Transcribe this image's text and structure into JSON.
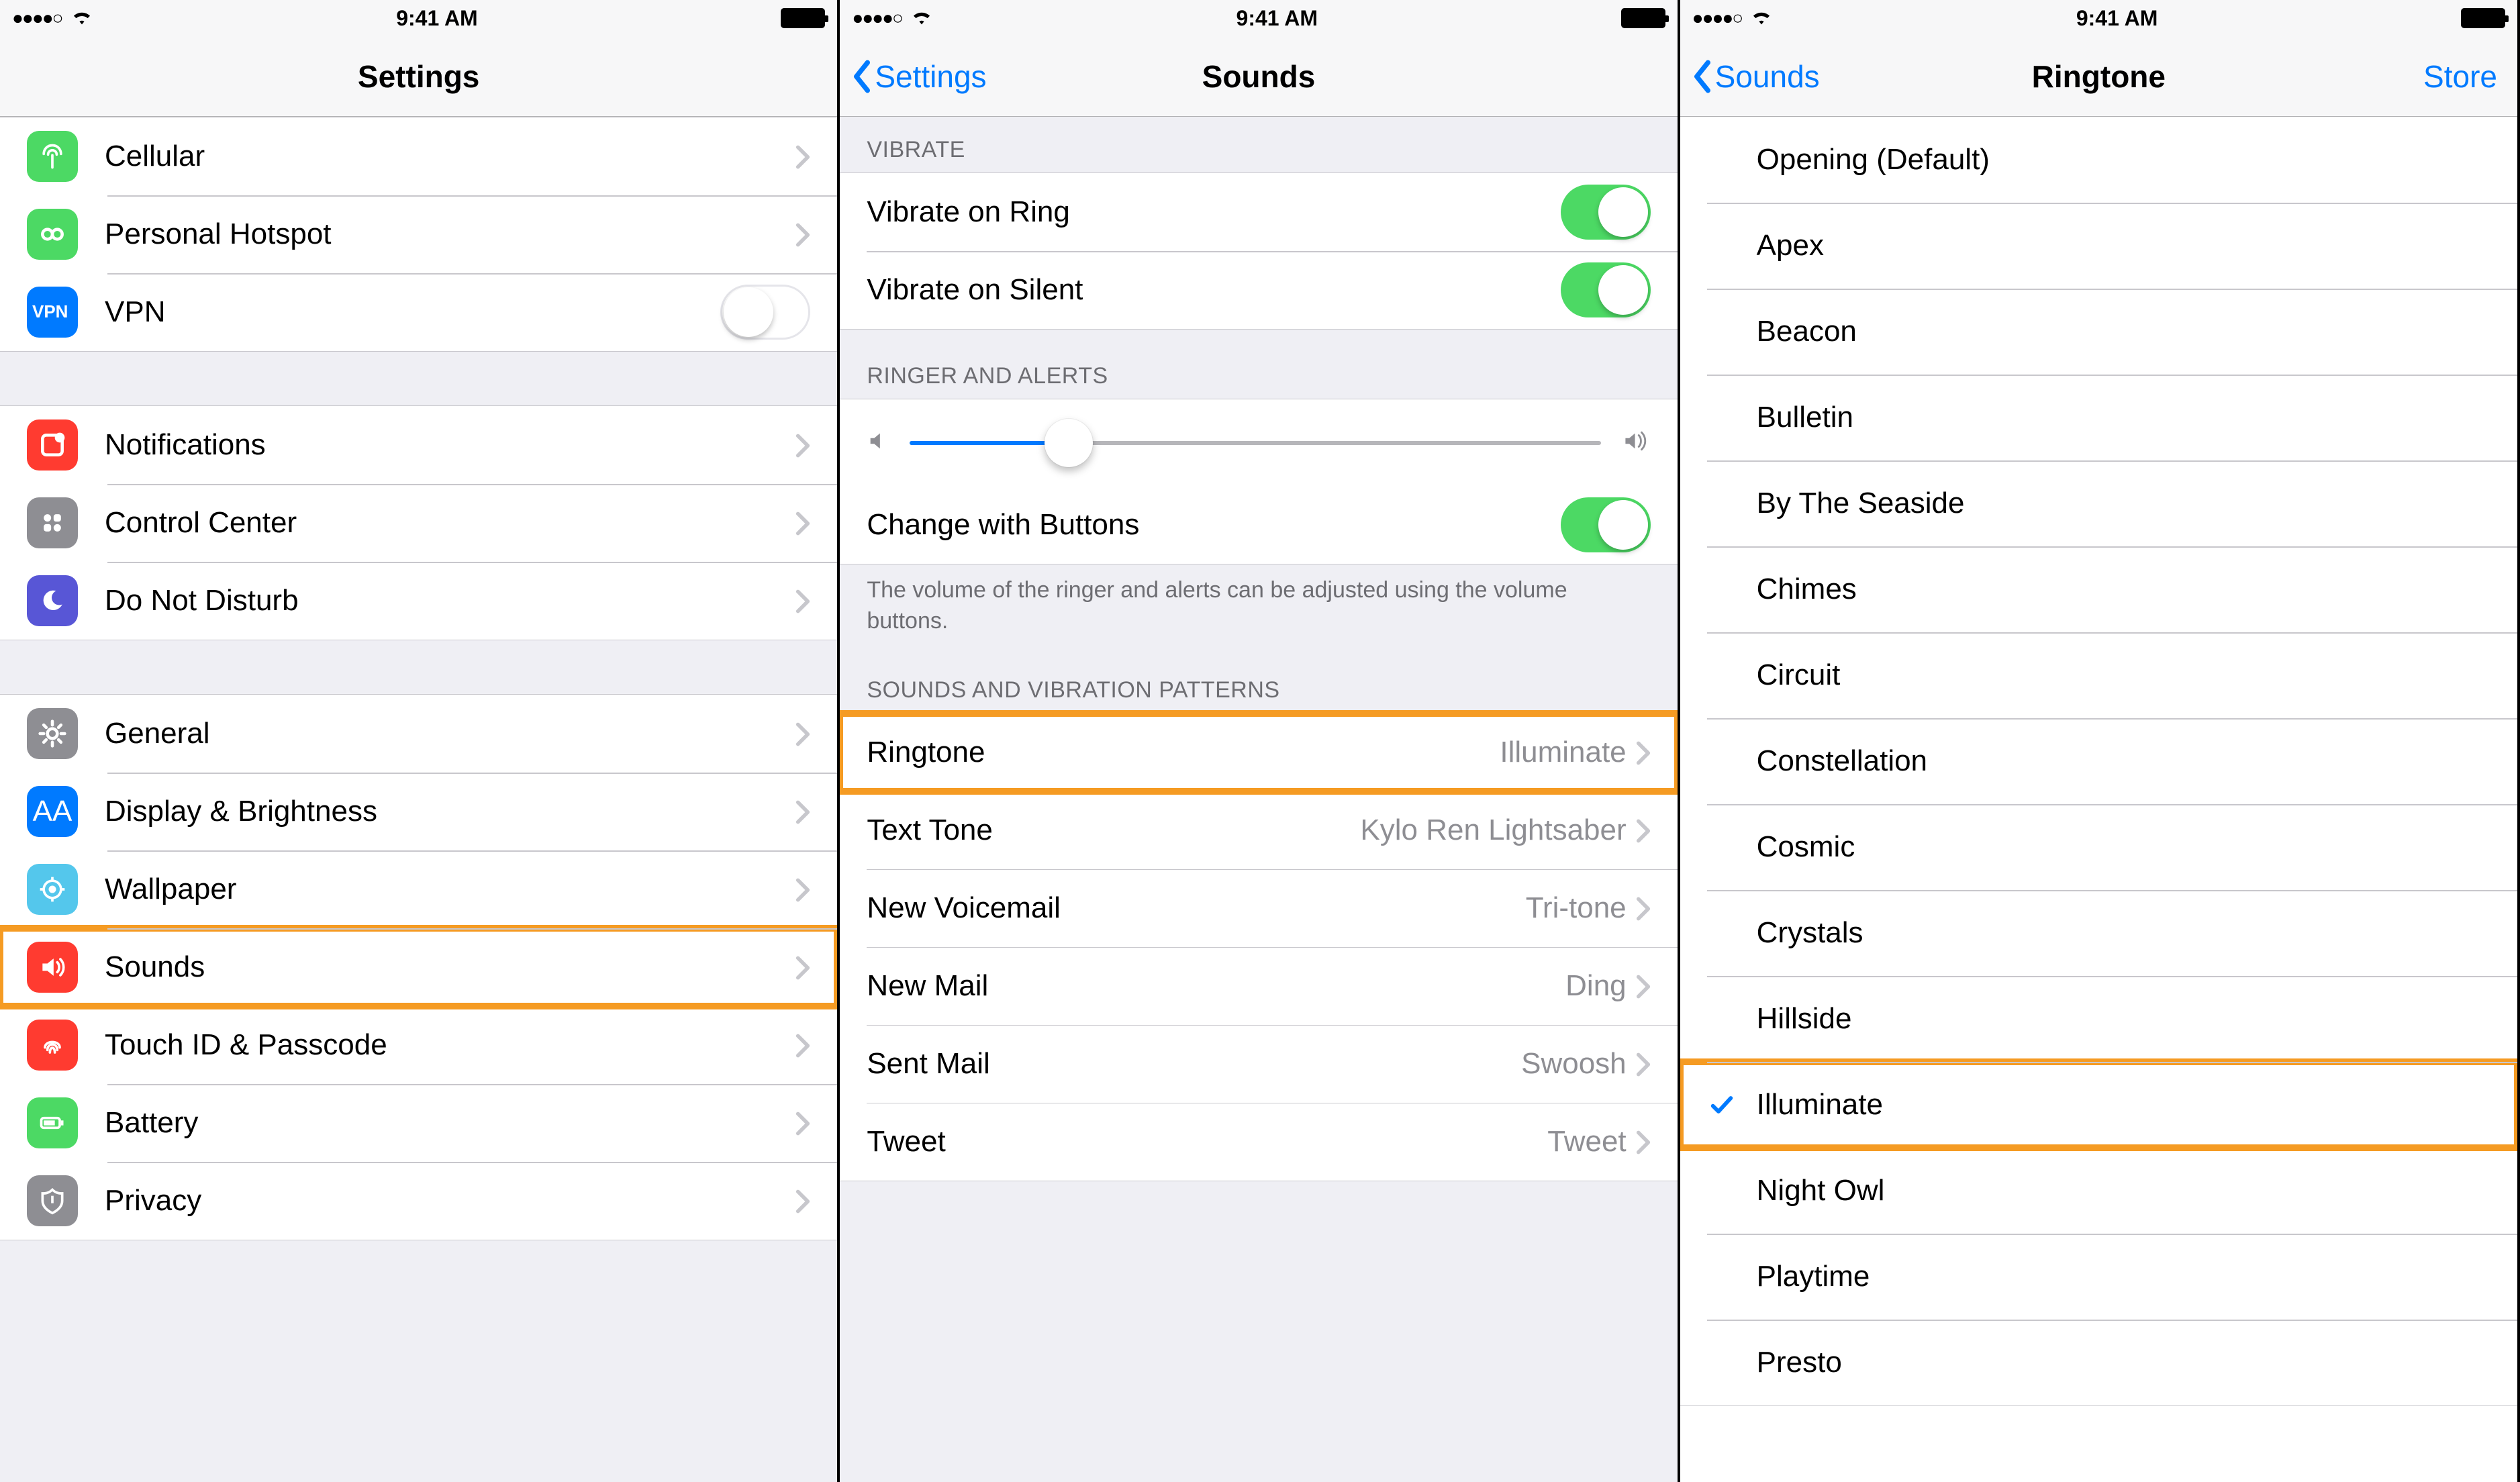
{
  "status": {
    "signal": "●●●●○",
    "time": "9:41 AM"
  },
  "screen1": {
    "title": "Settings",
    "group1": [
      {
        "icon": "cellular",
        "color": "#4cd964",
        "label": "Cellular"
      },
      {
        "icon": "hotspot",
        "color": "#4cd964",
        "label": "Personal Hotspot"
      },
      {
        "icon": "vpn",
        "color": "#007aff",
        "label": "VPN",
        "toggle": false
      }
    ],
    "group2": [
      {
        "icon": "notifications",
        "color": "#ff3b30",
        "label": "Notifications"
      },
      {
        "icon": "control",
        "color": "#8e8e93",
        "label": "Control Center"
      },
      {
        "icon": "dnd",
        "color": "#5856d6",
        "label": "Do Not Disturb"
      }
    ],
    "group3": [
      {
        "icon": "general",
        "color": "#8e8e93",
        "label": "General"
      },
      {
        "icon": "display",
        "color": "#007aff",
        "label": "Display & Brightness"
      },
      {
        "icon": "wallpaper",
        "color": "#54c7ec",
        "label": "Wallpaper"
      },
      {
        "icon": "sounds",
        "color": "#ff3b30",
        "label": "Sounds",
        "highlight": true
      },
      {
        "icon": "touchid",
        "color": "#ff3b30",
        "label": "Touch ID & Passcode"
      },
      {
        "icon": "battery",
        "color": "#4cd964",
        "label": "Battery"
      },
      {
        "icon": "privacy",
        "color": "#8e8e93",
        "label": "Privacy"
      }
    ]
  },
  "screen2": {
    "back": "Settings",
    "title": "Sounds",
    "sections": {
      "vibrate_header": "VIBRATE",
      "vibrate": [
        {
          "label": "Vibrate on Ring",
          "on": true
        },
        {
          "label": "Vibrate on Silent",
          "on": true
        }
      ],
      "ringer_header": "RINGER AND ALERTS",
      "change_buttons": {
        "label": "Change with Buttons",
        "on": true
      },
      "ringer_footer": "The volume of the ringer and alerts can be adjusted using the volume buttons.",
      "patterns_header": "SOUNDS AND VIBRATION PATTERNS",
      "patterns": [
        {
          "label": "Ringtone",
          "value": "Illuminate",
          "highlight": true
        },
        {
          "label": "Text Tone",
          "value": "Kylo Ren Lightsaber"
        },
        {
          "label": "New Voicemail",
          "value": "Tri-tone"
        },
        {
          "label": "New Mail",
          "value": "Ding"
        },
        {
          "label": "Sent Mail",
          "value": "Swoosh"
        },
        {
          "label": "Tweet",
          "value": "Tweet"
        }
      ]
    }
  },
  "screen3": {
    "back": "Sounds",
    "title": "Ringtone",
    "right": "Store",
    "items": [
      {
        "label": "Opening (Default)"
      },
      {
        "label": "Apex"
      },
      {
        "label": "Beacon"
      },
      {
        "label": "Bulletin"
      },
      {
        "label": "By The Seaside"
      },
      {
        "label": "Chimes"
      },
      {
        "label": "Circuit"
      },
      {
        "label": "Constellation"
      },
      {
        "label": "Cosmic"
      },
      {
        "label": "Crystals"
      },
      {
        "label": "Hillside"
      },
      {
        "label": "Illuminate",
        "selected": true,
        "highlight": true
      },
      {
        "label": "Night Owl"
      },
      {
        "label": "Playtime"
      },
      {
        "label": "Presto"
      }
    ]
  }
}
